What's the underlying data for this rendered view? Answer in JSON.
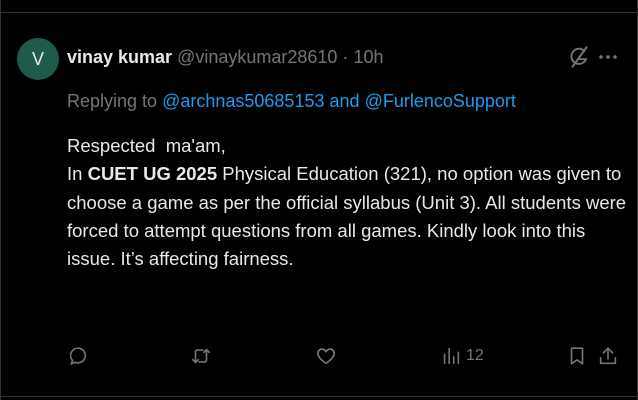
{
  "tweet": {
    "avatar_letter": "V",
    "avatar_color": "#1f5a4a",
    "display_name": "vinay kumar",
    "handle": "@vinaykumar28610",
    "separator": "·",
    "time": "10h",
    "replying_prefix": "Replying to",
    "reply_to_1": "@archnas50685153",
    "reply_and": "and",
    "reply_to_2": "@FurlencoSupport",
    "greeting": "Respected  ma'am,",
    "body_in": "In",
    "body_bold": "CUET UG 2025",
    "body_rest": " Physical Education (321), no option was given to choose a game as per the official syllabus (Unit 3). All students were forced to attempt questions from all games. Kindly look into this issue. It’s affecting fairness."
  },
  "actions": {
    "reply_icon": "reply-icon",
    "retweet_icon": "retweet-icon",
    "like_icon": "heart-icon",
    "views_icon": "views-icon",
    "views_count": "12",
    "bookmark_icon": "bookmark-icon",
    "share_icon": "share-icon"
  },
  "header_icons": {
    "grok": "grok-icon",
    "more": "more-icon"
  },
  "colors": {
    "background": "#000000",
    "text": "#e7e9ea",
    "muted": "#71767b",
    "link": "#1d9bf0"
  }
}
